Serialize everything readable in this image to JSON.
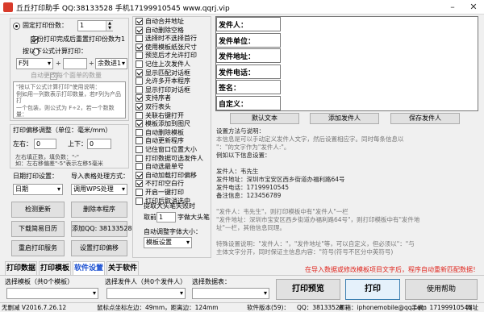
{
  "window": {
    "title": "丘丘打印助手  QQ:38133528  手机17199910545  www.qqrj.vip",
    "min_label": "–",
    "close_label": "✕"
  },
  "left_panel": {
    "fixed_count_label": "固定打印份数：",
    "fixed_count_value": "1",
    "reset_after_multi_label": "多份打印完成后重置打印份数为1",
    "formula_label": "按以下公式计算打印：",
    "formula_col": "F列",
    "formula_op1": "÷",
    "formula_mid": "",
    "formula_op2": "÷",
    "formula_round": "余数进1",
    "auto_changed_label": "自动更改每个面单的数量",
    "formula_help": "\"按以下公式计算打印\"使用说明：\n例如用一列数表示打印数量，若F列为产品打\n一个包装，则公式为 F÷2，若一个数数量：\n若选择\"余数进1\"则打印出的快递单，\n若选择\"舍去余数\"，则打印快递单。",
    "offset_title": "打印偏移调整（单位：毫米/mm）",
    "left_label": "左右：",
    "left_value": "0",
    "up_label": "上下：",
    "up_value": "0",
    "offset_help": "左右填正数，填负数：\"-\"\n如：左右移偏差\"-5\"表示左移5毫米",
    "date_settings_label": "日期打印设置：",
    "date_value": "日期",
    "import_format_label": "导入表格处理方式：",
    "import_value": "调用WPS处理"
  },
  "left_buttons": {
    "check_update": "检测更新",
    "delete_template": "删除本程序",
    "download_tutorial": "下载简易日历",
    "add_qq": "添加QQ: 38133528",
    "restart_service": "重启打印服务",
    "set_offset": "设置打印偏移"
  },
  "mid_checks": [
    {
      "label": "自动合并地址",
      "on": true
    },
    {
      "label": "自动删除空格",
      "on": true
    },
    {
      "label": "选择时不选择首行",
      "on": false
    },
    {
      "label": "使用模板纸张尺寸",
      "on": true
    },
    {
      "label": "预览后才允许打印",
      "on": false
    },
    {
      "label": "记住上次发件人",
      "on": false
    },
    {
      "label": "显示匹配对话框",
      "on": true
    },
    {
      "label": "允许多开本程序",
      "on": false
    },
    {
      "label": "显示打印对话框",
      "on": false
    },
    {
      "label": "支持序者",
      "on": true
    },
    {
      "label": "双行表头",
      "on": true
    },
    {
      "label": "关联右键打开",
      "on": false
    },
    {
      "label": "模板添加到图尺",
      "on": true
    },
    {
      "label": "自动删除模板",
      "on": false
    },
    {
      "label": "自动更新程序",
      "on": false
    },
    {
      "label": "记住窗口位置大小",
      "on": false
    },
    {
      "label": "打印数据可选发件人",
      "on": false
    },
    {
      "label": "自动选最单号",
      "on": false
    },
    {
      "label": "自动加载打印偏移",
      "on": true
    },
    {
      "label": "不打印空白行",
      "on": true
    },
    {
      "label": "开启一键打印",
      "on": false
    },
    {
      "label": "打印后取消选中",
      "on": false
    }
  ],
  "mid_extra": {
    "max_title": "提取大头笔失败时",
    "max_prefix": "取前",
    "max_value": "1",
    "max_suffix": "字做大头笔",
    "scale_label": "自动调整字体大小：",
    "scale_value": "模板设置"
  },
  "right_fields": [
    "发件人：",
    "发件单位：",
    "发件地址：",
    "发件电话：",
    "签名：",
    "自定义："
  ],
  "right_buttons": {
    "default_text": "默认文本",
    "add_sender": "添加发件人",
    "save_sender": "保存发件人"
  },
  "right_info": [
    {
      "text": "设置方法与说明：",
      "dim": false
    },
    {
      "text": "本信息是可以手动定义发件人文字，然后设置相应字。同时每条信息以",
      "dim": true
    },
    {
      "text": "\"：\"的文字作为\"发件人:\"。",
      "dim": true
    },
    {
      "text": "例如以下信息设置：",
      "dim": false
    },
    {
      "text": "",
      "dim": false
    },
    {
      "text": "发件人：韦先生",
      "dim": false
    },
    {
      "text": "发件地址：深圳市宝安区西乡街道办福利路64号",
      "dim": false
    },
    {
      "text": "发件电话：17199910545",
      "dim": false
    },
    {
      "text": "备注信息：123456789",
      "dim": false
    },
    {
      "text": "",
      "dim": false
    },
    {
      "text": "\"发件人：韦先生\"，则打印模板中有\"发件人\"一栏",
      "dim": true
    },
    {
      "text": "\"发件地址：深圳市宝安区西乡街道办福利路64号\"，则打印模板中有\"发件地",
      "dim": true
    },
    {
      "text": "址\"一栏，其他信息同理。",
      "dim": true
    },
    {
      "text": "",
      "dim": false
    },
    {
      "text": "特殊设置说明：\"发件人：\"，\"发件地址\"等，可以自定义，但必须以\"：\"与",
      "dim": true
    },
    {
      "text": "主体文字分开，同时保证主信息内容：\"符号(符号不区分中英符号)",
      "dim": true
    }
  ],
  "tabs": [
    {
      "label": "打印数据",
      "active": false
    },
    {
      "label": "打印模板",
      "active": false
    },
    {
      "label": "软件设置",
      "active": true
    },
    {
      "label": "关于软件",
      "active": false
    }
  ],
  "notice": {
    "text": "在导入数据或修改模板项目文字后，程序自动重新匹配数据！",
    "color": "#e0271f"
  },
  "bottom_bar": {
    "template_label": "选择模板（共0个模板）",
    "template_value": "",
    "sender_label": "选择发件人（共0个发件人）",
    "sender_value": "",
    "data_label": "选择数据表：",
    "data_value": "",
    "preview": "打印预览",
    "print": "打印",
    "print_all": "使用帮助"
  },
  "status": {
    "version": "无删减 V2016.7.26.12",
    "mouse": "鼠标点坐标左边：49mm，距离边：124mm",
    "software_version": "软件版本(59)：",
    "qq": "QQ：38133528",
    "email": "邮箱：iphonemobile@qq.com",
    "phone": "手机：17199910545",
    "site": "网址"
  },
  "colors": {
    "accent_tab": "#1a4fd1",
    "notice_red": "#e0271f"
  }
}
